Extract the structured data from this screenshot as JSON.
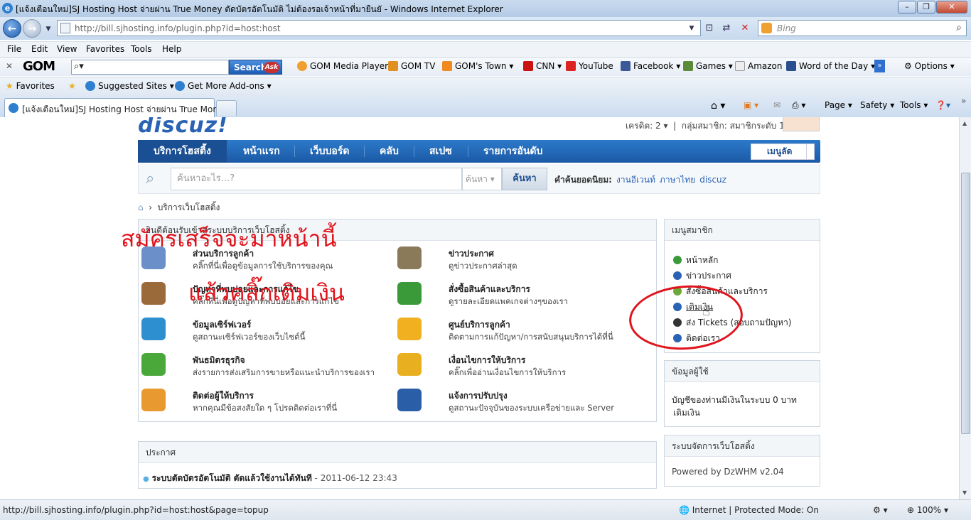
{
  "window": {
    "title": "[แจ้งเตือนใหม่]SJ Hosting Host จ่ายผ่าน True Money ตัดบัตรอัตโนมัติ ไม่ต้องรอเจ้าหน้าที่มายืนยั - Windows Internet Explorer",
    "url": "http://bill.sjhosting.info/plugin.php?id=host:host",
    "search_placeholder": "Bing"
  },
  "menu": [
    "File",
    "Edit",
    "View",
    "Favorites",
    "Tools",
    "Help"
  ],
  "gom_toolbar": {
    "search_button": "Search",
    "ask": "Ask",
    "items": [
      "GOM Media Player",
      "GOM TV",
      "GOM's Town",
      "CNN",
      "YouTube",
      "Facebook",
      "Games",
      "Amazon",
      "Word of the Day",
      "Options"
    ]
  },
  "favorites_bar": {
    "favorites": "Favorites",
    "suggested": "Suggested Sites",
    "addons": "Get More Add-ons"
  },
  "tab": {
    "label": "[แจ้งเตือนใหม่]SJ Hosting Host จ่ายผ่าน True Mone...",
    "commands": [
      "Page",
      "Safety",
      "Tools"
    ]
  },
  "page": {
    "logo": "discuz!",
    "credits": "เครดิต: 2",
    "group": "กลุ่มสมาชิก: สมาชิกระดับ 1",
    "nav": [
      "บริการโฮสติ้ง",
      "หน้าแรก",
      "เว็บบอร์ด",
      "คลับ",
      "สเปซ",
      "รายการอันดับ"
    ],
    "menu_button": "เมนูลัด",
    "search": {
      "placeholder": "ค้นหาอะไร...?",
      "select": "ค้นหา",
      "button": "ค้นหา",
      "hot_label": "คำค้นยอดนิยม:",
      "hot": [
        "งานอีเวนท์",
        "ภาษาไทย",
        "discuz"
      ]
    },
    "breadcrumb": "บริการเว็บโฮสติ้ง",
    "services_header": "ยินดีต้อนรับเข้าสู่ระบบบริการเว็บโฮสติ้ง",
    "services": [
      {
        "title": "ส่วนบริการลูกค้า",
        "desc": "คลิ๊กที่นี่เพื่อดูข้อมูลการใช้บริการของคุณ",
        "color": "#6b8fc9"
      },
      {
        "title": "ข่าวประกาศ",
        "desc": "ดูข่าวประกาศล่าสุด",
        "color": "#8a7a5a"
      },
      {
        "title": "ปัญหาที่พบบ่อยและการแก้ไข",
        "desc": "คลิ๊กที่นี่เพื่อดูปัญหาที่พบบ่อยและการแก้ไข",
        "color": "#9a6a3a"
      },
      {
        "title": "สั่งซื้อสินค้าและบริการ",
        "desc": "ดูรายละเอียดแพคเกจต่างๆของเรา",
        "color": "#3a9a3a"
      },
      {
        "title": "ข้อมูลเซิร์ฟเวอร์",
        "desc": "ดูสถานะเซิร์ฟเวอร์ของเว็บไซต์นี้",
        "color": "#2e8fd0"
      },
      {
        "title": "ศูนย์บริการลูกค้า",
        "desc": "ติดตามการแก้ปัญหา/การสนับสนุนบริการได้ที่นี่",
        "color": "#f0b020"
      },
      {
        "title": "พันธมิตรธุรกิจ",
        "desc": "ส่งรายการส่งเสริมการขายหรือแนะนำบริการของเรา",
        "color": "#4aa83a"
      },
      {
        "title": "เงื่อนไขการให้บริการ",
        "desc": "คลิ๊กเพื่ออ่านเงื่อนไขการให้บริการ",
        "color": "#e8b020"
      },
      {
        "title": "ติดต่อผู้ให้บริการ",
        "desc": "หากคุณมีข้อสงสัยใด ๆ โปรดติดต่อเราที่นี่",
        "color": "#e89a30"
      },
      {
        "title": "แจ้งการปรับปรุง",
        "desc": "ดูสถานะปัจจุบันของระบบเครือข่ายและ Server",
        "color": "#2a5fa8"
      }
    ],
    "announce_header": "ประกาศ",
    "announce": "ระบบตัดบัตรอัตโนมัติ ตัดแล้วใช้งานได้ทันที",
    "announce_date": " - 2011-06-12 23:43",
    "member_menu_header": "เมนูสมาชิก",
    "member_menu": [
      {
        "label": "หน้าหลัก",
        "color": "#3a9a3a"
      },
      {
        "label": "ข่าวประกาศ",
        "color": "#2a63b4"
      },
      {
        "label": "สั่งซื้อสินค้าและบริการ",
        "color": "#6aa83a"
      },
      {
        "label": "เติมเงิน",
        "color": "#2a63b4"
      },
      {
        "label": "ส่ง Tickets (สอบถามปัญหา)",
        "color": "#333333"
      },
      {
        "label": "ติดต่อเรา",
        "color": "#2a63b4"
      }
    ],
    "user_info_header": "ข้อมูลผู้ใช้",
    "balance": "บัญชีของท่านมีเงินในระบบ 0 บาท",
    "topup_link": "เติมเงิน",
    "host_mgmt_header": "ระบบจัดการเว็บโฮสติ้ง",
    "powered": "Powered by DzWHM v2.04",
    "annotation_line1": "สมัครเสร็จจะมาหน้านี้",
    "annotation_line2": "แล้วคลิ๊กเติมเงิน"
  },
  "status": {
    "url": "http://bill.sjhosting.info/plugin.php?id=host:host&page=topup",
    "zone": "Internet | Protected Mode: On",
    "zoom": "100%"
  }
}
